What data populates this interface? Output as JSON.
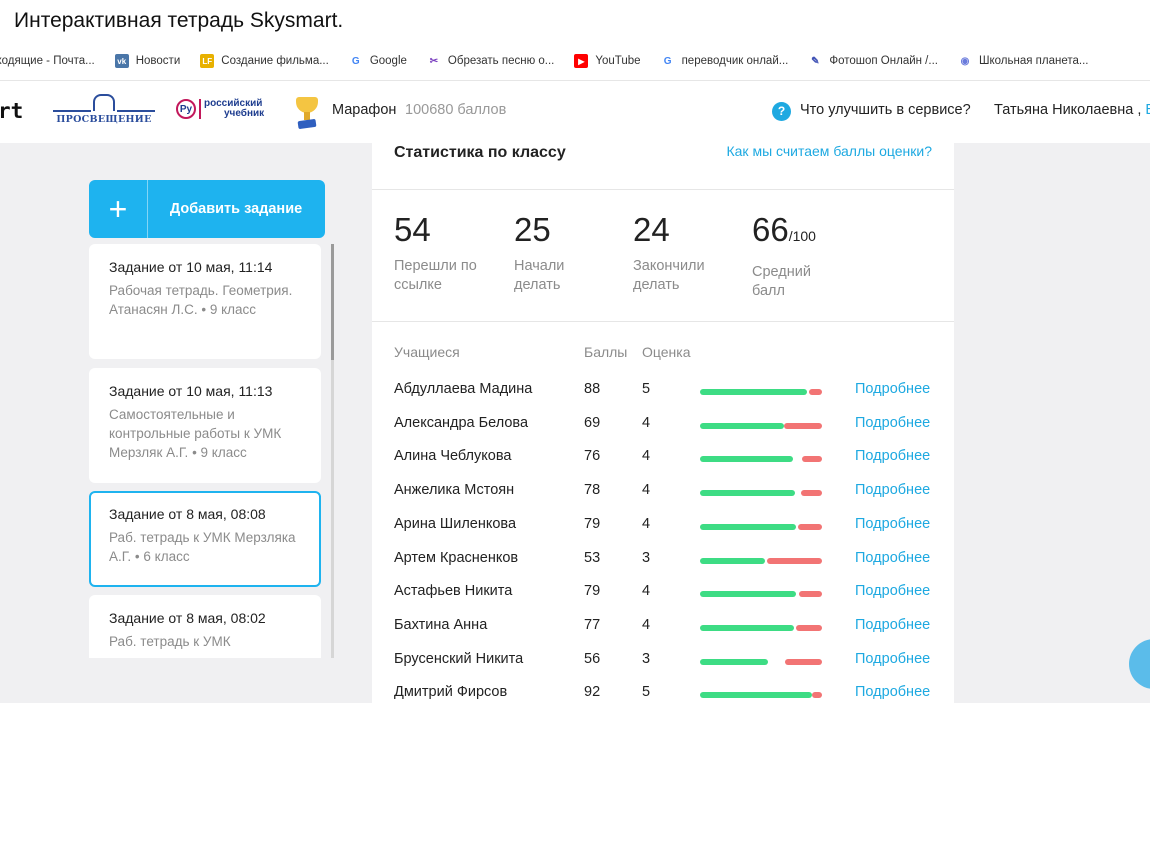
{
  "doc_title": "Интерактивная тетрадь Skysmart.",
  "bookmarks": [
    {
      "label": "ходящие - Почта...",
      "icon": "mail-icon",
      "color": "#777777"
    },
    {
      "label": "Новости",
      "icon": "vk-icon",
      "color": "#4a76a8"
    },
    {
      "label": "Создание фильма...",
      "icon": "lf-icon",
      "color": "#e8b100"
    },
    {
      "label": "Google",
      "icon": "google-icon",
      "color": "#4285f4"
    },
    {
      "label": "Обрезать песню о...",
      "icon": "scissors-icon",
      "color": "#7a3fbf"
    },
    {
      "label": "YouTube",
      "icon": "youtube-icon",
      "color": "#ff0000"
    },
    {
      "label": "переводчик онлай...",
      "icon": "google-icon",
      "color": "#4285f4"
    },
    {
      "label": "Фотошоп Онлайн /...",
      "icon": "photoshop-icon",
      "color": "#3f51b5"
    },
    {
      "label": "Школьная планета...",
      "icon": "planet-icon",
      "color": "#6a7bdc"
    }
  ],
  "header": {
    "logo_text": "rt",
    "prosv_logo": "ПРОСВЕЩЕНИЕ",
    "rus_logo_a": "Ру",
    "rus_logo_b": "российский",
    "rus_logo_c": "учебник",
    "marathon_label": "Марафон",
    "points_label": "100680 баллов",
    "help_icon_glyph": "?",
    "help_label": "Что улучшить в сервисе?",
    "user_name": "Татьяна Николаевна ,",
    "exit_label": "В"
  },
  "sidebar": {
    "add_icon_glyph": "+",
    "add_label": "Добавить задание",
    "tasks": [
      {
        "title": "Задание от 10 мая, 11:14",
        "desc": "Рабочая тетрадь. Геометрия. Атанасян Л.С. • 9 класс"
      },
      {
        "title": "Задание от 10 мая, 11:13",
        "desc": "Самостоятельные и контрольные работы к УМК Мерзляк А.Г. • 9 класс"
      },
      {
        "title": "Задание от 8 мая, 08:08",
        "desc": "Раб. тетрадь к УМК Мерзляка А.Г. • 6 класс"
      },
      {
        "title": "Задание от 8 мая, 08:02",
        "desc": "Раб. тетрадь к УМК"
      }
    ]
  },
  "stats": {
    "title": "Статистика по классу",
    "how_link": "Как мы считаем баллы оценки?",
    "followed": {
      "value": "54",
      "label": "Перешли по ссылке"
    },
    "started": {
      "value": "25",
      "label": "Начали делать"
    },
    "finished": {
      "value": "24",
      "label": "Закончили делать"
    },
    "average": {
      "value": "66",
      "suffix": "/100",
      "label": "Средний балл"
    },
    "headers": {
      "student": "Учащиеся",
      "score": "Баллы",
      "grade": "Оценка"
    },
    "more_label": "Подробнее",
    "students": [
      {
        "name": "Абдуллаева Мадина",
        "score": "88",
        "grade": "5",
        "correct": 0.88,
        "wrong": 0.11
      },
      {
        "name": "Александра Белова",
        "score": "69",
        "grade": "4",
        "correct": 0.69,
        "wrong": 0.31
      },
      {
        "name": "Алина Чеблукова",
        "score": "76",
        "grade": "4",
        "correct": 0.76,
        "wrong": 0.16
      },
      {
        "name": "Анжелика Мстоян",
        "score": "78",
        "grade": "4",
        "correct": 0.78,
        "wrong": 0.17
      },
      {
        "name": "Арина Шиленкова",
        "score": "79",
        "grade": "4",
        "correct": 0.79,
        "wrong": 0.2
      },
      {
        "name": "Артем Красненков",
        "score": "53",
        "grade": "3",
        "correct": 0.53,
        "wrong": 0.45
      },
      {
        "name": "Астафьев Никита",
        "score": "79",
        "grade": "4",
        "correct": 0.79,
        "wrong": 0.19
      },
      {
        "name": "Бахтина Анна",
        "score": "77",
        "grade": "4",
        "correct": 0.77,
        "wrong": 0.21
      },
      {
        "name": "Брусенский Никита",
        "score": "56",
        "grade": "3",
        "correct": 0.56,
        "wrong": 0.3
      },
      {
        "name": "Дмитрий Фирсов",
        "score": "92",
        "grade": "5",
        "correct": 0.92,
        "wrong": 0.08
      }
    ]
  }
}
